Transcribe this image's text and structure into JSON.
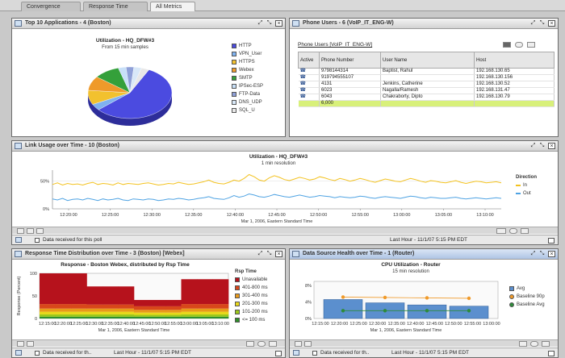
{
  "tabs": [
    {
      "label": "Convergence"
    },
    {
      "label": "Response Time"
    },
    {
      "label": "All Metrics"
    }
  ],
  "colors": {
    "pie": [
      "#4b4be0",
      "#7fb2f0",
      "#f2c12e",
      "#ef9a2a",
      "#34a03a",
      "#c8e0f8",
      "#8fa0d8",
      "#d8e8f8",
      "#e8e8e8"
    ],
    "panel_header_blue": "#aec4e4"
  },
  "top_apps": {
    "title": "Top 10 Applications - 4 (Boston)",
    "chart_title": "Utilization - HQ_DFW#3",
    "chart_subtitle": "From 15 min samples",
    "legend": [
      {
        "label": "HTTP"
      },
      {
        "label": "VPN_User"
      },
      {
        "label": "HTTPS"
      },
      {
        "label": "Webex"
      },
      {
        "label": "SMTP"
      },
      {
        "label": "IPSec-ESP"
      },
      {
        "label": "FTP-Data"
      },
      {
        "label": "DNS_UDP"
      },
      {
        "label": "SQL_U"
      }
    ]
  },
  "chart_data": [
    {
      "type": "pie",
      "title": "Utilization - HQ_DFW#3",
      "subtitle": "From 15 min samples",
      "categories": [
        "HTTP",
        "VPN_User",
        "HTTPS",
        "Webex",
        "SMTP",
        "IPSec-ESP",
        "FTP-Data",
        "DNS_UDP",
        "SQL_U"
      ],
      "values": [
        56,
        4,
        9,
        9,
        10,
        3,
        3,
        3,
        3
      ]
    },
    {
      "type": "line",
      "title": "Utilization - HQ_DFW#3",
      "subtitle": "1 min resolution",
      "xlabel": "Mar 1, 2006, Eastern Standard Time",
      "ylabel": "",
      "x_ticks": [
        "12:20:00",
        "12:25:00",
        "12:30:00",
        "12:35:00",
        "12:40:00",
        "12:45:00",
        "12:50:00",
        "12:55:00",
        "13:00:00",
        "13:05:00",
        "13:10:00"
      ],
      "y_ticks": [
        "0%",
        "50%"
      ],
      "ylim": [
        0,
        70
      ],
      "legend_title": "Direction",
      "legend_position": "right",
      "series": [
        {
          "name": "In",
          "color": "#f3c21f",
          "values": [
            44,
            47,
            43,
            46,
            44,
            45,
            43,
            46,
            48,
            44,
            46,
            45,
            43,
            47,
            44,
            46,
            45,
            44,
            46,
            47,
            45,
            43,
            44,
            46,
            45,
            48,
            46,
            44,
            45,
            47,
            49,
            52,
            48,
            46,
            45,
            48,
            52,
            50,
            55,
            62,
            58,
            52,
            50,
            56,
            60,
            57,
            53,
            51,
            54,
            57,
            55,
            52,
            54,
            58,
            56,
            53,
            51,
            55,
            53,
            50,
            52,
            55,
            53,
            50,
            48,
            51,
            54,
            52,
            50,
            49,
            52,
            55,
            53,
            50,
            48,
            51,
            50,
            48,
            47,
            49,
            51,
            48,
            46,
            48,
            50,
            49,
            47,
            48,
            49,
            47
          ]
        },
        {
          "name": "Out",
          "color": "#4fa3e3",
          "values": [
            18,
            16,
            19,
            15,
            17,
            18,
            16,
            19,
            17,
            15,
            18,
            16,
            17,
            19,
            16,
            15,
            18,
            17,
            16,
            18,
            17,
            15,
            16,
            18,
            17,
            19,
            18,
            16,
            17,
            19,
            20,
            22,
            19,
            18,
            17,
            20,
            24,
            21,
            23,
            27,
            25,
            22,
            21,
            23,
            26,
            24,
            22,
            21,
            23,
            25,
            23,
            21,
            22,
            24,
            23,
            22,
            20,
            22,
            21,
            20,
            21,
            23,
            22,
            20,
            19,
            21,
            22,
            21,
            20,
            19,
            21,
            23,
            22,
            20,
            19,
            21,
            20,
            19,
            19,
            20,
            21,
            19,
            18,
            19,
            20,
            19,
            18,
            19,
            20,
            19
          ]
        }
      ]
    },
    {
      "type": "area",
      "title": "Response - Boston Webex, distributed by Rsp Time",
      "xlabel": "Mar 1, 2006, Eastern Standard Time",
      "ylabel": "Response (Percent)",
      "x_ticks": [
        "12:15:00",
        "12:20:00",
        "12:25:00",
        "12:30:00",
        "12:35:00",
        "12:40:00",
        "12:45:00",
        "12:50:00",
        "12:55:00",
        "13:00:00",
        "13:05:00",
        "13:10:00"
      ],
      "y_ticks": [
        "0",
        "50",
        "100"
      ],
      "ylim": [
        0,
        100
      ],
      "legend_title": "Rsp Time",
      "series": [
        {
          "name": "Unavailable",
          "color": "#b6121c",
          "values": [
            68,
            68,
            68,
            40,
            40,
            40,
            14,
            14,
            14,
            55,
            55,
            55
          ]
        },
        {
          "name": "401-800 ms",
          "color": "#d8471a",
          "values": [
            10,
            10,
            10,
            9,
            9,
            9,
            8,
            8,
            8,
            10,
            10,
            10
          ]
        },
        {
          "name": "301-400 ms",
          "color": "#e89a1a",
          "values": [
            7,
            7,
            7,
            7,
            7,
            7,
            6,
            6,
            6,
            7,
            7,
            7
          ]
        },
        {
          "name": "201-300 ms",
          "color": "#e8d81a",
          "values": [
            6,
            6,
            6,
            6,
            6,
            6,
            5,
            5,
            5,
            6,
            6,
            6
          ]
        },
        {
          "name": "101-200 ms",
          "color": "#9cc81a",
          "values": [
            5,
            5,
            5,
            5,
            5,
            5,
            4,
            4,
            4,
            5,
            5,
            5
          ]
        },
        {
          "name": "<= 100 ms",
          "color": "#2f8f2a",
          "values": [
            4,
            4,
            4,
            4,
            4,
            4,
            4,
            4,
            4,
            4,
            4,
            4
          ]
        }
      ]
    },
    {
      "type": "bar",
      "title": "CPU Utilization - Router",
      "subtitle": "15 min resolution",
      "xlabel": "Mar 1, 2006, Eastern Standard Time",
      "ylabel": "",
      "x_ticks": [
        "12:15:00",
        "12:20:00",
        "12:25:00",
        "12:30:00",
        "12:35:00",
        "12:40:00",
        "12:45:00",
        "12:50:00",
        "12:55:00",
        "13:00:00"
      ],
      "categories": [
        "12:15",
        "12:30",
        "12:45",
        "13:00"
      ],
      "y_ticks": [
        "0%",
        "4%",
        "8%"
      ],
      "ylim": [
        0,
        9
      ],
      "series": [
        {
          "name": "Avg",
          "color": "#5b8fce",
          "values": [
            4.6,
            3.8,
            3.3,
            3.0
          ]
        },
        {
          "name": "Baseline 90p",
          "color": "#f09a2a",
          "values": [
            5.2,
            5.1,
            5.0,
            4.9
          ]
        },
        {
          "name": "Baseline Avg",
          "color": "#2e8b3a",
          "values": [
            1.9,
            1.9,
            1.9,
            1.9
          ]
        }
      ]
    }
  ],
  "phone_users": {
    "title": "Phone Users - 6 (VoIP_IT_ENG-W)",
    "subtitle": "Phone Users [VoIP_IT_ENG-W]",
    "columns": [
      "Active",
      "Phone Number",
      "User Name",
      "Host"
    ],
    "rows": [
      {
        "number": "9798144314",
        "name": "Baptist, Rahul",
        "host": "192.168.130.65"
      },
      {
        "number": "919794555107",
        "name": "",
        "host": "192.168.130.156"
      },
      {
        "number": "4131",
        "name": "Jenkins, Catherine",
        "host": "192.168.130.52"
      },
      {
        "number": "6023",
        "name": "Nagalla/Ramesh",
        "host": "192.168.131.47"
      },
      {
        "number": "6043",
        "name": "Chakraborty, Dipto",
        "host": "192.168.130.79"
      }
    ],
    "footer": "6,000"
  },
  "link_usage": {
    "title": "Link Usage over Time - 10 (Boston)",
    "chart_title": "Utilization - HQ_DFW#3",
    "chart_subtitle": "1 min resolution",
    "legend_title": "Direction",
    "legend": [
      {
        "label": "In"
      },
      {
        "label": "Out"
      }
    ],
    "status_check": "Data received for this poll",
    "status_range": "Last Hour - 11/1/07 5:15 PM EDT"
  },
  "resp_dist": {
    "title": "Response Time Distribution over Time - 3 (Boston) [Webex]",
    "chart_title": "Response - Boston Webex, distributed by Rsp Time",
    "legend_title": "Rsp Time",
    "legend": [
      {
        "label": "Unavailable"
      },
      {
        "label": "401-800 ms"
      },
      {
        "label": "301-400 ms"
      },
      {
        "label": "201-300 ms"
      },
      {
        "label": "101-200 ms"
      },
      {
        "label": "<= 100 ms"
      }
    ],
    "status_check": "Data received for th..",
    "status_range": "Last Hour - 11/1/07 5:15 PM EDT"
  },
  "ds_health": {
    "title": "Data Source Health over Time - 1 (Router)",
    "chart_title": "CPU Utilization - Router",
    "chart_subtitle": "15 min resolution",
    "legend": [
      {
        "label": "Avg"
      },
      {
        "label": "Baseline 90p"
      },
      {
        "label": "Baseline Avg"
      }
    ],
    "status_check": "Data received for th..",
    "status_range": "Last Hour - 11/1/07 5:15 PM EDT"
  }
}
